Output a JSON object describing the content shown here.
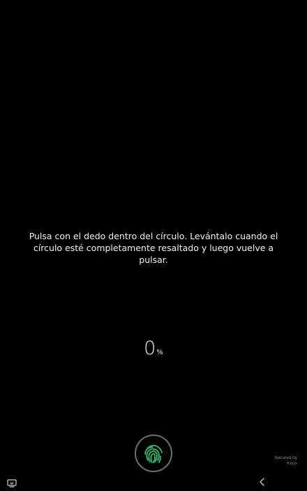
{
  "instruction": {
    "text": "Pulsa con el dedo dentro del círculo. Levántalo cuando el círculo esté completamente resaltado y luego vuelve a pulsar."
  },
  "progress": {
    "value": "0",
    "unit": "%"
  },
  "fingerprint": {
    "icon": "fingerprint-icon",
    "accent_color": "#1fc46a",
    "ring_color": "#6e6e6e"
  },
  "footer": {
    "secured_line1": "Secured by",
    "secured_line2": "Knox"
  },
  "navbar": {
    "left_icon": "screen-switch-icon",
    "back_icon": "back-icon"
  }
}
